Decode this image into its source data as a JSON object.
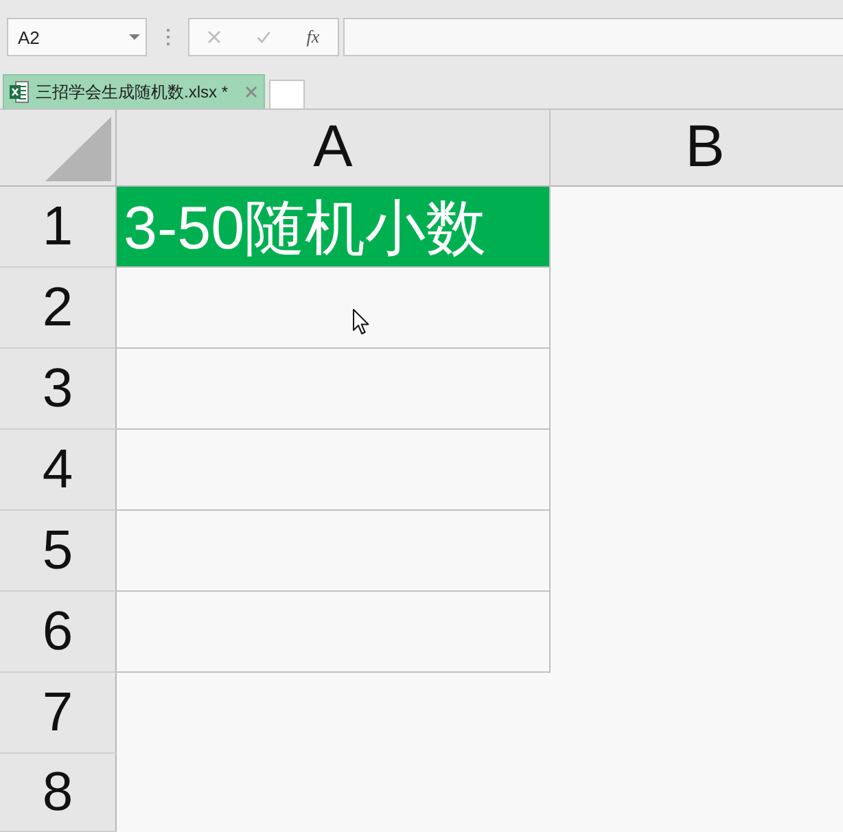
{
  "name_box": {
    "value": "A2"
  },
  "formula_bar": {
    "buttons": [
      {
        "kind": "cancel",
        "disabled": true
      },
      {
        "kind": "enter",
        "disabled": true
      },
      {
        "kind": "function",
        "label": "fx",
        "disabled": false
      }
    ]
  },
  "document_tabs": [
    {
      "label": "三招学会生成随机数.xlsx *",
      "selected": true
    }
  ],
  "sheet": {
    "columns": [
      "A",
      "B"
    ],
    "rows": [
      {
        "header": "1",
        "cells": [
          {
            "text": "3-50随机小数",
            "color": "#00b050",
            "bordered": true
          }
        ]
      },
      {
        "header": "2",
        "cells": [
          {
            "bordered": true
          }
        ]
      },
      {
        "header": "3",
        "cells": [
          {
            "bordered": true
          }
        ]
      },
      {
        "header": "4",
        "cells": [
          {
            "bordered": true
          }
        ]
      },
      {
        "header": "5",
        "cells": [
          {
            "bordered": true
          }
        ]
      },
      {
        "header": "6",
        "cells": [
          {
            "bordered": true
          }
        ]
      },
      {
        "header": "7",
        "cells": [
          {
            "bordered": false
          }
        ]
      },
      {
        "header": "8",
        "cells": [
          {
            "bordered": false
          }
        ]
      }
    ]
  }
}
